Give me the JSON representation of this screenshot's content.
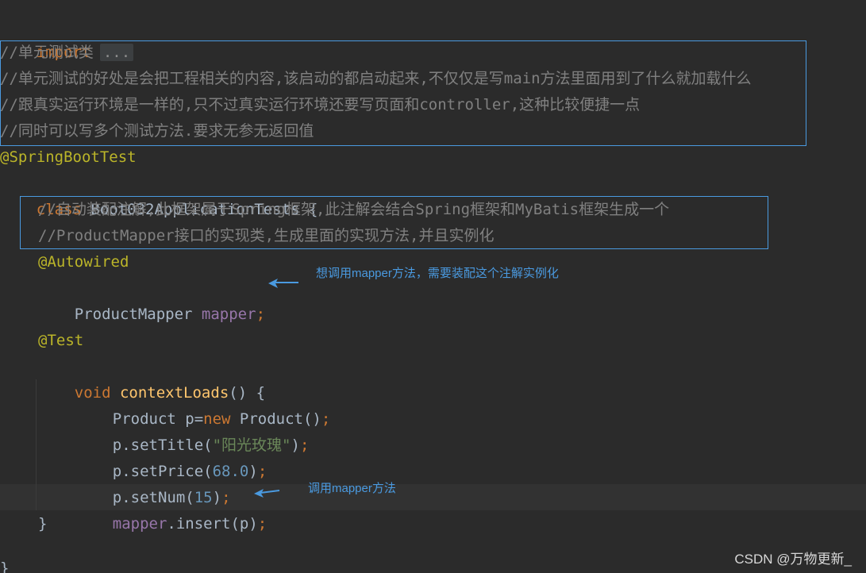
{
  "code": {
    "import_kw": "import",
    "import_fold": "...",
    "comment_lines": [
      "//单元测试类",
      "//单元测试的好处是会把工程相关的内容,该启动的都启动起来,不仅仅是写main方法里面用到了什么就加载什么",
      "//跟真实运行环境是一样的,只不过真实运行环境还要写页面和controller,这种比较便捷一点",
      "//同时可以写多个测试方法.要求无参无返回值"
    ],
    "class_annotation": "@SpringBootTest",
    "class_kw": "class",
    "class_name": " Boot032ApplicationTests {",
    "field_comments": [
      "//自动装配注解,此框架属于Spring框架,此注解会结合Spring框架和MyBatis框架生成一个",
      "//ProductMapper接口的实现类,生成里面的实现方法,并且实例化"
    ],
    "field_annotation": "@Autowired",
    "field_type": "ProductMapper ",
    "field_name": "mapper",
    "semicolon": ";",
    "test_annotation": "@Test",
    "void_kw": "void",
    "method_name": "contextLoads",
    "method_sig_rest": "() {",
    "stmt1": {
      "a": "Product p=",
      "new_kw": "new",
      "b": " Product()",
      "semi": ";"
    },
    "stmt2": {
      "a": "p.setTitle(",
      "str": "\"阳光玫瑰\"",
      "b": ")",
      "semi": ";"
    },
    "stmt3": {
      "a": "p.setPrice(",
      "num": "68.0",
      "b": ")",
      "semi": ";"
    },
    "stmt4": {
      "a": "p.setNum(",
      "num": "15",
      "b": ")",
      "semi": ";"
    },
    "stmt5": {
      "field": "mapper",
      "a": ".insert(p)",
      "semi": ";"
    },
    "method_close": "}",
    "class_close": "}"
  },
  "annotations": {
    "note_autowired": "想调用mapper方法，需要装配这个注解实例化",
    "note_insert": "调用mapper方法"
  },
  "watermark": "CSDN @万物更新_",
  "colors": {
    "background": "#2b2b2b",
    "keyword": "#cc7832",
    "annotation": "#bbb529",
    "comment": "#808080",
    "field": "#9876aa",
    "method": "#ffc66d",
    "number": "#6897bb",
    "string": "#6a8759",
    "callout": "#4a9ae0"
  }
}
